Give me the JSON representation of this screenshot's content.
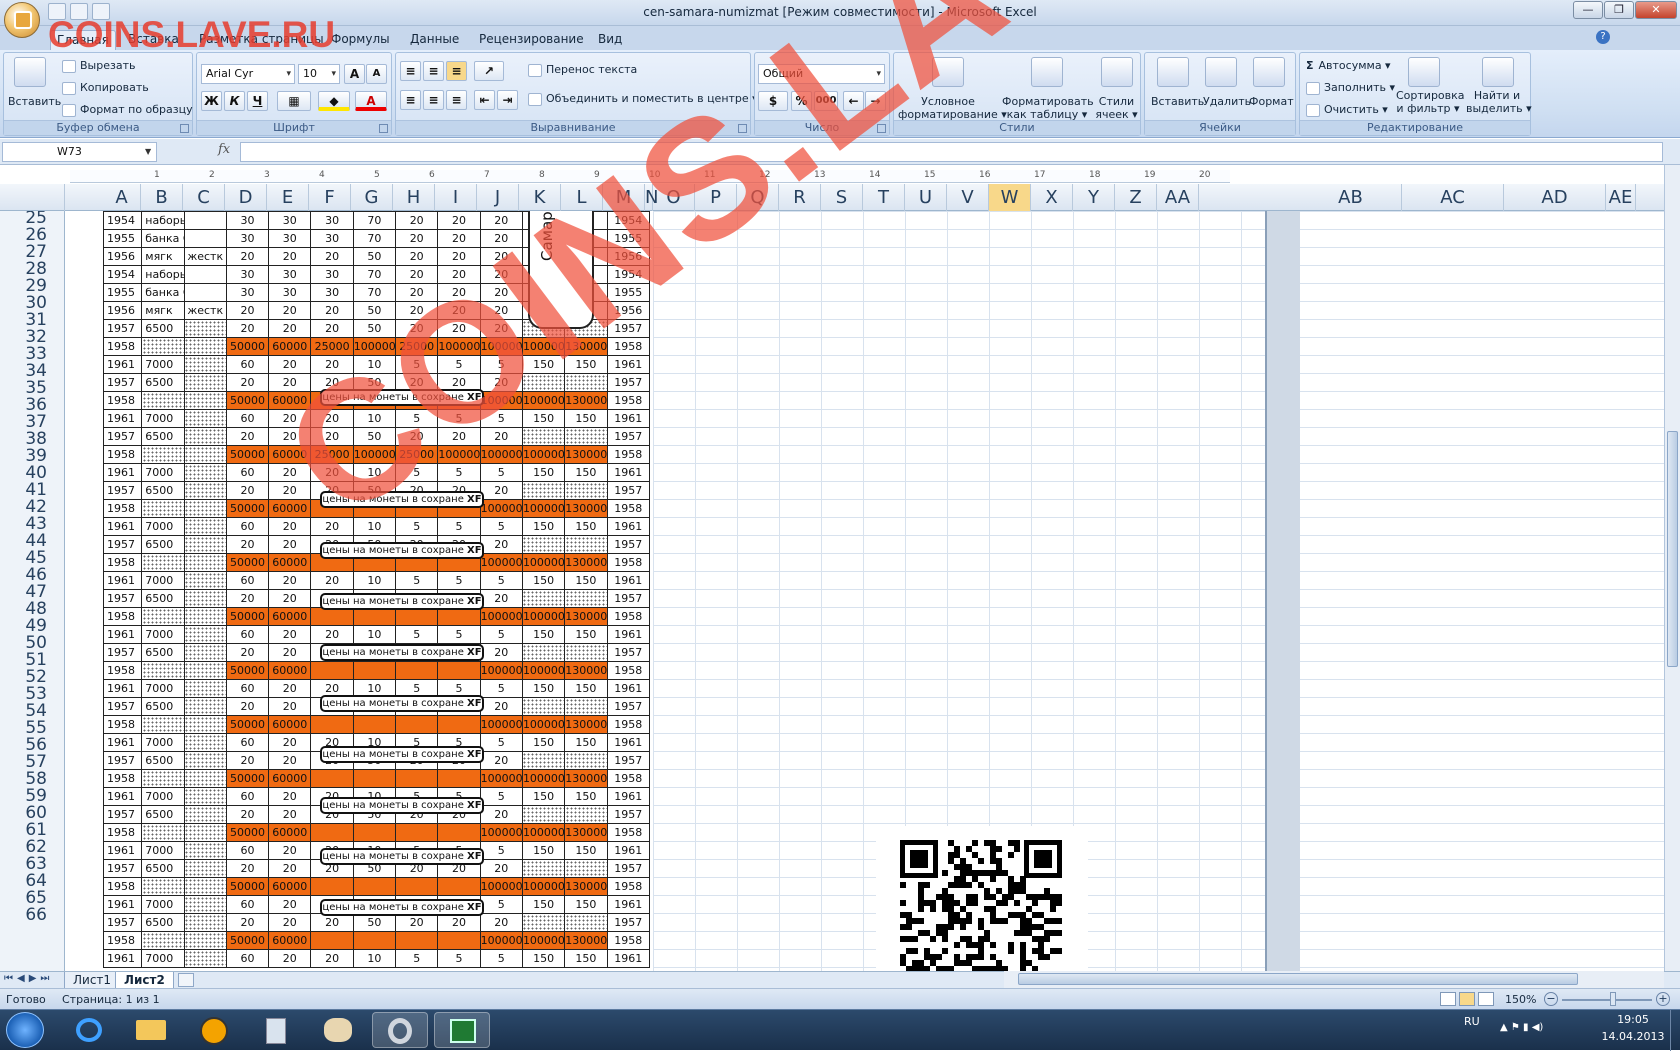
{
  "window": {
    "title": "cen-samara-numizmat  [Режим совместимости] - Microsoft Excel"
  },
  "watermark": {
    "top": "COINS.LAVE.RU",
    "diagonal": "COINS.LAVE.RU"
  },
  "tabs": [
    "Главная",
    "Вставка",
    "Разметка страницы",
    "Формулы",
    "Данные",
    "Рецензирование",
    "Вид"
  ],
  "ribbon": {
    "clipboard": {
      "paste": "Вставить",
      "cut": "Вырезать",
      "copy": "Копировать",
      "format_painter": "Формат по образцу",
      "title": "Буфер обмена"
    },
    "font": {
      "name": "Arial Cyr",
      "size": "10",
      "bold": "Ж",
      "italic": "К",
      "underline": "Ч",
      "grow": "A",
      "shrink": "A",
      "color": "A",
      "title": "Шрифт"
    },
    "alignment": {
      "wrap": "Перенос текста",
      "merge": "Объединить и поместить в центре",
      "title": "Выравнивание"
    },
    "number": {
      "format": "Общий",
      "percent": "%",
      "thousands": "000",
      "title": "Число"
    },
    "styles": {
      "conditional": "Условное",
      "conditional2": "форматирование",
      "as_table": "Форматировать",
      "as_table2": "как таблицу",
      "cell_styles": "Стили",
      "cell_styles2": "ячеек",
      "title": "Стили"
    },
    "cells": {
      "insert": "Вставить",
      "delete": "Удалить",
      "format": "Формат",
      "title": "Ячейки"
    },
    "editing": {
      "autosum": "Автосумма",
      "fill": "Заполнить",
      "clear": "Очистить",
      "sort": "Сортировка",
      "sort2": "и фильтр",
      "find": "Найти и",
      "find2": "выделить",
      "title": "Редактирование"
    }
  },
  "formula_bar": {
    "name_box": "W73",
    "fx": "fx",
    "value": ""
  },
  "columns": [
    "A",
    "B",
    "C",
    "D",
    "E",
    "F",
    "G",
    "H",
    "I",
    "J",
    "K",
    "L",
    "M",
    "N",
    "O",
    "P",
    "Q",
    "R",
    "S",
    "T",
    "U",
    "V",
    "W",
    "X",
    "Y",
    "Z",
    "AA",
    "AB",
    "AC",
    "AD",
    "AE"
  ],
  "ruler_ticks": [
    "1",
    "2",
    "3",
    "4",
    "5",
    "6",
    "7",
    "8",
    "9",
    "10",
    "11",
    "12",
    "13",
    "14",
    "15",
    "16",
    "17",
    "18",
    "19",
    "20"
  ],
  "rows": [
    "25",
    "26",
    "27",
    "28",
    "29",
    "30",
    "31",
    "32",
    "33",
    "34",
    "35",
    "36",
    "37",
    "38",
    "39",
    "40",
    "41",
    "42",
    "43",
    "44",
    "45",
    "46",
    "47",
    "48",
    "49",
    "50",
    "51",
    "52",
    "53",
    "54",
    "55",
    "56",
    "57",
    "58",
    "59",
    "60",
    "61",
    "62",
    "63",
    "64",
    "65",
    "66"
  ],
  "table": [
    [
      "1954",
      "наборы",
      "",
      "30",
      "30",
      "30",
      "70",
      "20",
      "20",
      "20",
      "",
      "",
      "1954"
    ],
    [
      "1955",
      "банка СССР",
      "",
      "30",
      "30",
      "30",
      "70",
      "20",
      "20",
      "20",
      "",
      "",
      "1955"
    ],
    [
      "1956",
      "мягк",
      "жестк",
      "20",
      "20",
      "20",
      "50",
      "20",
      "20",
      "20",
      "",
      "",
      "1956"
    ],
    [
      "1954",
      "наборы",
      "",
      "30",
      "30",
      "30",
      "70",
      "20",
      "20",
      "20",
      "",
      "",
      "1954"
    ],
    [
      "1955",
      "банка СССР",
      "",
      "30",
      "30",
      "30",
      "70",
      "20",
      "20",
      "20",
      "",
      "",
      "1955"
    ],
    [
      "1956",
      "мягк",
      "жестк",
      "20",
      "20",
      "20",
      "50",
      "20",
      "20",
      "20",
      "",
      "",
      "1956"
    ],
    [
      "1957",
      "6500",
      "",
      "20",
      "20",
      "20",
      "50",
      "20",
      "20",
      "20",
      "",
      "",
      "1957"
    ],
    [
      "1958",
      "",
      "",
      "50000",
      "60000",
      "25000",
      "100000",
      "25000",
      "100000",
      "100000",
      "100000",
      "130000",
      "1958"
    ],
    [
      "1961",
      "7000",
      "",
      "60",
      "20",
      "20",
      "10",
      "5",
      "5",
      "5",
      "150",
      "150",
      "1961"
    ],
    [
      "1957",
      "6500",
      "",
      "20",
      "20",
      "20",
      "50",
      "20",
      "20",
      "20",
      "",
      "",
      "1957"
    ],
    [
      "1958",
      "",
      "",
      "50000",
      "60000",
      "",
      "",
      "",
      "",
      "100000",
      "100000",
      "130000",
      "1958"
    ],
    [
      "1961",
      "7000",
      "",
      "60",
      "20",
      "20",
      "10",
      "5",
      "5",
      "5",
      "150",
      "150",
      "1961"
    ],
    [
      "1957",
      "6500",
      "",
      "20",
      "20",
      "20",
      "50",
      "20",
      "20",
      "20",
      "",
      "",
      "1957"
    ],
    [
      "1958",
      "",
      "",
      "50000",
      "60000",
      "25000",
      "100000",
      "25000",
      "100000",
      "100000",
      "100000",
      "130000",
      "1958"
    ],
    [
      "1961",
      "7000",
      "",
      "60",
      "20",
      "20",
      "10",
      "5",
      "5",
      "5",
      "150",
      "150",
      "1961"
    ],
    [
      "1957",
      "6500",
      "",
      "20",
      "20",
      "20",
      "50",
      "20",
      "20",
      "20",
      "",
      "",
      "1957"
    ],
    [
      "1958",
      "",
      "",
      "50000",
      "60000",
      "",
      "",
      "",
      "",
      "100000",
      "100000",
      "130000",
      "1958"
    ],
    [
      "1961",
      "7000",
      "",
      "60",
      "20",
      "20",
      "10",
      "5",
      "5",
      "5",
      "150",
      "150",
      "1961"
    ],
    [
      "1957",
      "6500",
      "",
      "20",
      "20",
      "20",
      "50",
      "20",
      "20",
      "20",
      "",
      "",
      "1957"
    ],
    [
      "1958",
      "",
      "",
      "50000",
      "60000",
      "",
      "",
      "",
      "",
      "100000",
      "100000",
      "130000",
      "1958"
    ],
    [
      "1961",
      "7000",
      "",
      "60",
      "20",
      "20",
      "10",
      "5",
      "5",
      "5",
      "150",
      "150",
      "1961"
    ],
    [
      "1957",
      "6500",
      "",
      "20",
      "20",
      "20",
      "50",
      "20",
      "20",
      "20",
      "",
      "",
      "1957"
    ],
    [
      "1958",
      "",
      "",
      "50000",
      "60000",
      "",
      "",
      "",
      "",
      "100000",
      "100000",
      "130000",
      "1958"
    ],
    [
      "1961",
      "7000",
      "",
      "60",
      "20",
      "20",
      "10",
      "5",
      "5",
      "5",
      "150",
      "150",
      "1961"
    ],
    [
      "1957",
      "6500",
      "",
      "20",
      "20",
      "20",
      "50",
      "20",
      "20",
      "20",
      "",
      "",
      "1957"
    ],
    [
      "1958",
      "",
      "",
      "50000",
      "60000",
      "",
      "",
      "",
      "",
      "100000",
      "100000",
      "130000",
      "1958"
    ],
    [
      "1961",
      "7000",
      "",
      "60",
      "20",
      "20",
      "10",
      "5",
      "5",
      "5",
      "150",
      "150",
      "1961"
    ],
    [
      "1957",
      "6500",
      "",
      "20",
      "20",
      "20",
      "50",
      "20",
      "20",
      "20",
      "",
      "",
      "1957"
    ],
    [
      "1958",
      "",
      "",
      "50000",
      "60000",
      "",
      "",
      "",
      "",
      "100000",
      "100000",
      "130000",
      "1958"
    ],
    [
      "1961",
      "7000",
      "",
      "60",
      "20",
      "20",
      "10",
      "5",
      "5",
      "5",
      "150",
      "150",
      "1961"
    ],
    [
      "1957",
      "6500",
      "",
      "20",
      "20",
      "20",
      "50",
      "20",
      "20",
      "20",
      "",
      "",
      "1957"
    ],
    [
      "1958",
      "",
      "",
      "50000",
      "60000",
      "",
      "",
      "",
      "",
      "100000",
      "100000",
      "130000",
      "1958"
    ],
    [
      "1961",
      "7000",
      "",
      "60",
      "20",
      "20",
      "10",
      "5",
      "5",
      "5",
      "150",
      "150",
      "1961"
    ],
    [
      "1957",
      "6500",
      "",
      "20",
      "20",
      "20",
      "50",
      "20",
      "20",
      "20",
      "",
      "",
      "1957"
    ],
    [
      "1958",
      "",
      "",
      "50000",
      "60000",
      "",
      "",
      "",
      "",
      "100000",
      "100000",
      "130000",
      "1958"
    ],
    [
      "1961",
      "7000",
      "",
      "60",
      "20",
      "20",
      "10",
      "5",
      "5",
      "5",
      "150",
      "150",
      "1961"
    ],
    [
      "1957",
      "6500",
      "",
      "20",
      "20",
      "20",
      "50",
      "20",
      "20",
      "20",
      "",
      "",
      "1957"
    ],
    [
      "1958",
      "",
      "",
      "50000",
      "60000",
      "",
      "",
      "",
      "",
      "100000",
      "100000",
      "130000",
      "1958"
    ],
    [
      "1961",
      "7000",
      "",
      "60",
      "20",
      "20",
      "10",
      "5",
      "5",
      "5",
      "150",
      "150",
      "1961"
    ],
    [
      "1957",
      "6500",
      "",
      "20",
      "20",
      "20",
      "50",
      "20",
      "20",
      "20",
      "",
      "",
      "1957"
    ],
    [
      "1958",
      "",
      "",
      "50000",
      "60000",
      "",
      "",
      "",
      "",
      "100000",
      "100000",
      "130000",
      "1958"
    ],
    [
      "1961",
      "7000",
      "",
      "60",
      "20",
      "20",
      "10",
      "5",
      "5",
      "5",
      "150",
      "150",
      "1961"
    ]
  ],
  "note_text": "цены на монеты в сохране",
  "note_grade": "XF",
  "capsule_label": "Самар",
  "sheets": [
    "Лист1",
    "Лист2"
  ],
  "active_sheet": "Лист2",
  "status": {
    "ready": "Готово",
    "page": "Страница: 1 из 1",
    "zoom": "150%"
  },
  "tray": {
    "lang": "RU",
    "time": "19:05",
    "date": "14.04.2013"
  },
  "colors": {
    "orange": "#f06a12",
    "ribbon": "#cfdff2",
    "watermark": "#f0503c"
  }
}
